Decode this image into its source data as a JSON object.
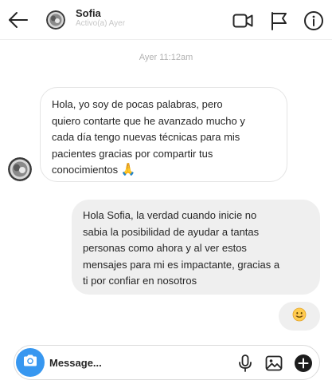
{
  "header": {
    "name": "Sofia",
    "status": "Activo(a) Ayer",
    "icons": [
      "back-arrow-icon",
      "video-call-icon",
      "flag-icon",
      "info-icon"
    ]
  },
  "conversation": {
    "timestamp": "Ayer 11:12am",
    "messages": [
      {
        "direction": "incoming",
        "sender": "Sofia",
        "lines": [
          "Hola, yo soy de pocas palabras, pero",
          "quiero contarte que he avanzado mucho y",
          "cada día tengo nuevas técnicas para mis",
          "pacientes gracias por compartir tus",
          "conocimientos"
        ],
        "emoji": "🙏"
      },
      {
        "direction": "outgoing",
        "lines": [
          "Hola Sofia, la verdad cuando inicie no",
          "sabia la posibilidad de ayudar a tantas",
          "personas como ahora y al ver estos",
          "mensajes para mi es impactante, gracias a",
          "ti por confiar en nosotros"
        ]
      },
      {
        "direction": "outgoing",
        "emoji": "😊"
      }
    ]
  },
  "composer": {
    "placeholder": "Message...",
    "icons": [
      "camera-icon",
      "microphone-icon",
      "image-icon",
      "plus-icon"
    ]
  },
  "colors": {
    "accent": "#3797f0",
    "incoming_bubble_border": "#e4e4e4",
    "outgoing_bubble_bg": "#efefef",
    "muted_text": "#c7c7c7"
  }
}
